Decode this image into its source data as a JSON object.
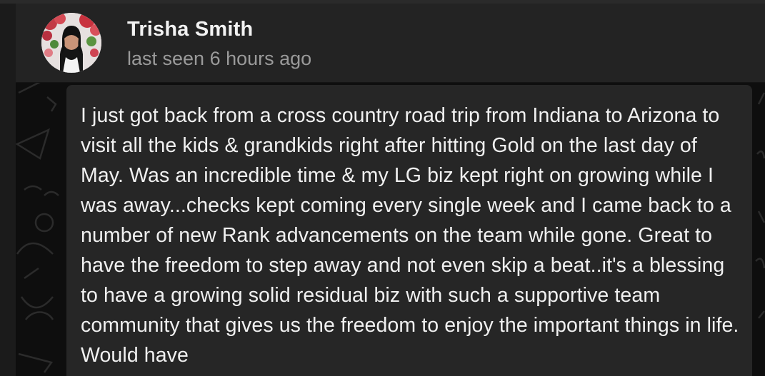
{
  "contact": {
    "name": "Trisha Smith",
    "status": "last seen 6 hours ago",
    "avatar_icon": "user-avatar-photo"
  },
  "message": {
    "text": "I just got back from a cross country road trip from Indiana to Arizona to visit all the kids & grandkids right after hitting Gold on the last day of May. Was an incredible time & my LG biz kept right on growing while I was away...checks kept coming every single week and I came back to a number of new Rank advancements on the team while gone. Great to have the freedom to step away and not even skip a beat..it's a blessing to have a growing solid residual biz with such a supportive team community that gives us the freedom to enjoy the important things in life. Would have"
  },
  "colors": {
    "header_bg": "#232323",
    "bubble_bg": "#262626",
    "name": "#f2f2f2",
    "status": "#9a9a9a",
    "message_text": "#f0f0f0"
  }
}
